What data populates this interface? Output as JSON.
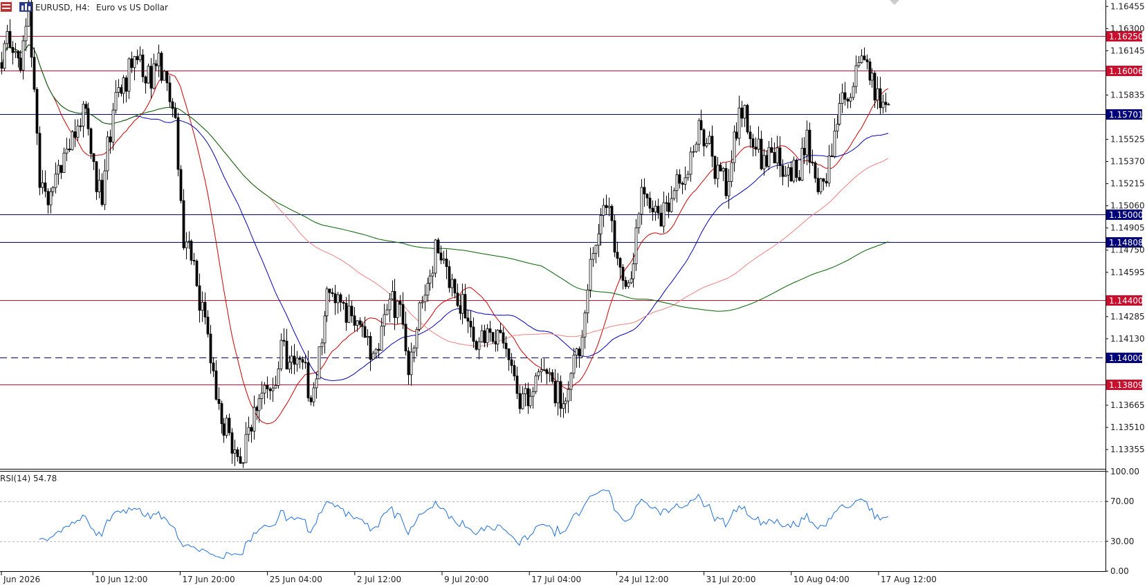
{
  "header": {
    "symbol": "EURUSD, H4:",
    "description": "Euro vs US Dollar"
  },
  "indicator_label": "RSI(14) 54.78",
  "colors": {
    "background": "#ffffff",
    "candle_body": "#000000",
    "red_level": "#c8102e",
    "blue_level": "#00007a",
    "ma_fast": "#cc0000",
    "ma_mid": "#0000bb",
    "ma_slow": "#f08080",
    "ma_long": "#006400",
    "rsi_line": "#1e6fd9"
  },
  "chart_data": [
    {
      "type": "candlestick",
      "title": "EURUSD, H4: Euro vs US Dollar",
      "x_tick_labels": [
        "Jun 2026",
        "10 Jun 12:00",
        "17 Jun 20:00",
        "25 Jun 04:00",
        "2 Jul 12:00",
        "9 Jul 20:00",
        "17 Jul 04:00",
        "24 Jul 12:00",
        "31 Jul 20:00",
        "10 Aug 04:00",
        "17 Aug 12:00"
      ],
      "y_tick_labels": [
        "1.16455",
        "1.16300",
        "1.16145",
        "1.15835",
        "1.15525",
        "1.15370",
        "1.15215",
        "1.15060",
        "1.14905",
        "1.14750",
        "1.14595",
        "1.14285",
        "1.14130",
        "1.13665",
        "1.13510",
        "1.13355"
      ],
      "ylim": [
        1.1322,
        1.165
      ],
      "levels": [
        {
          "value": "1.16250",
          "color": "red",
          "style": "solid"
        },
        {
          "value": "1.16006",
          "color": "red",
          "style": "solid"
        },
        {
          "value": "1.15701",
          "color": "blue",
          "style": "solid"
        },
        {
          "value": "1.15000",
          "color": "blue",
          "style": "solid"
        },
        {
          "value": "1.14808",
          "color": "blue",
          "style": "solid"
        },
        {
          "value": "1.14400",
          "color": "red",
          "style": "solid"
        },
        {
          "value": "1.14000",
          "color": "blue",
          "style": "dashed"
        },
        {
          "value": "1.13809",
          "color": "red",
          "style": "solid"
        }
      ],
      "price_anchors": [
        1.161,
        1.1625,
        1.16,
        1.164,
        1.1535,
        1.1502,
        1.153,
        1.1545,
        1.156,
        1.1575,
        1.154,
        1.1508,
        1.156,
        1.1585,
        1.16,
        1.1612,
        1.159,
        1.1605,
        1.1598,
        1.1575,
        1.1485,
        1.147,
        1.144,
        1.141,
        1.1365,
        1.1345,
        1.133,
        1.1338,
        1.137,
        1.139,
        1.1385,
        1.1405,
        1.1395,
        1.1405,
        1.1375,
        1.1395,
        1.1455,
        1.1445,
        1.1425,
        1.143,
        1.142,
        1.1405,
        1.142,
        1.144,
        1.1435,
        1.1385,
        1.143,
        1.145,
        1.1475,
        1.146,
        1.144,
        1.1438,
        1.142,
        1.141,
        1.1415,
        1.142,
        1.139,
        1.1375,
        1.137,
        1.1385,
        1.1395,
        1.138,
        1.1372,
        1.1395,
        1.1405,
        1.146,
        1.15,
        1.151,
        1.147,
        1.145,
        1.148,
        1.152,
        1.1505,
        1.15,
        1.151,
        1.1525,
        1.154,
        1.1555,
        1.155,
        1.153,
        1.1518,
        1.156,
        1.1575,
        1.1555,
        1.154,
        1.154,
        1.1535,
        1.153,
        1.1525,
        1.1555,
        1.152,
        1.1525,
        1.155,
        1.158,
        1.159,
        1.1605,
        1.1596,
        1.1582,
        1.1577
      ],
      "candles_count": 328,
      "ma_periods": [
        20,
        50,
        100,
        200
      ]
    },
    {
      "type": "line",
      "title": "RSI(14) 54.78",
      "y_tick_labels": [
        "100.00",
        "70.00",
        "30.00",
        "0.00"
      ],
      "ylim": [
        0,
        100
      ],
      "guides": [
        70,
        30
      ],
      "last_value": 54.78
    }
  ]
}
